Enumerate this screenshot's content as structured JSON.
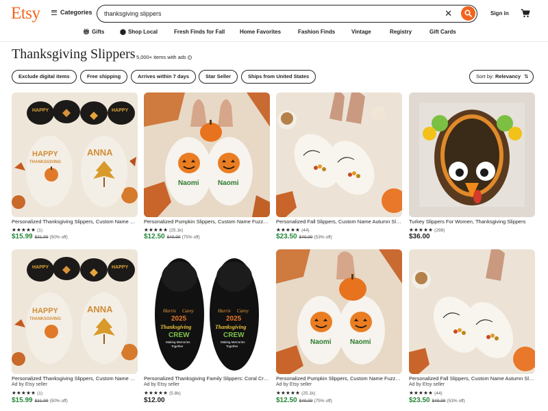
{
  "header": {
    "logo": "Etsy",
    "categories_label": "Categories",
    "search_value": "thanksgiving slippers",
    "signin_label": "Sign in"
  },
  "subnav": [
    {
      "label": "Gifts",
      "icon": "gift-icon"
    },
    {
      "label": "Shop Local",
      "icon": "location-pin-icon"
    },
    {
      "label": "Fresh Finds for Fall"
    },
    {
      "label": "Home Favorites"
    },
    {
      "label": "Fashion Finds"
    },
    {
      "label": "Vintage"
    },
    {
      "label": "Registry"
    },
    {
      "label": "Gift Cards"
    }
  ],
  "page": {
    "title": "Thanksgiving Slippers",
    "count": "5,000+ items with ads"
  },
  "filters": [
    "Exclude digital items",
    "Free shipping",
    "Arrives within 7 days",
    "Star Seller",
    "Ships from United States"
  ],
  "sort": {
    "prefix": "Sort by: ",
    "value": "Relevancy"
  },
  "listings": [
    {
      "title": "Personalized Thanksgiving Slippers, Custom Name Fall Slippers",
      "ad": "",
      "stars": "★★★★★",
      "reviews": "(1)",
      "price": "$15.99",
      "was": "$31.99",
      "off": "(50% off)",
      "sale": true
    },
    {
      "title": "Personalized Pumpkin Slippers, Custom Name Fuzzy Slippers",
      "ad": "",
      "stars": "★★★★★",
      "reviews": "(25.1k)",
      "price": "$12.50",
      "was": "$49.99",
      "off": "(75% off)",
      "sale": true
    },
    {
      "title": "Personalized Fall Slippers, Custom Name Autumn Slippers",
      "ad": "",
      "stars": "★★★★★",
      "reviews": "(44)",
      "price": "$23.50",
      "was": "$49.99",
      "off": "(53% off)",
      "sale": true
    },
    {
      "title": "Turkey Slippers For Women, Thanksgiving Slippers",
      "ad": "",
      "stars": "★★★★★",
      "reviews": "(298)",
      "price": "$36.00",
      "was": "",
      "off": "",
      "sale": false
    },
    {
      "title": "Personalized Thanksgiving Slippers, Custom Name Fall Slippers",
      "ad": "Ad by Etsy seller",
      "stars": "★★★★★",
      "reviews": "(1)",
      "price": "$15.99",
      "was": "$31.99",
      "off": "(50% off)",
      "sale": true
    },
    {
      "title": "Personalized Thanksgiving Family Slippers: Coral Crew Slippers",
      "ad": "Ad by Etsy seller",
      "stars": "★★★★★",
      "reviews": "(5.8k)",
      "price": "$12.00",
      "was": "",
      "off": "",
      "sale": false
    },
    {
      "title": "Personalized Pumpkin Slippers, Custom Name Fuzzy Slippers",
      "ad": "Ad by Etsy seller",
      "stars": "★★★★★",
      "reviews": "(25.1k)",
      "price": "$12.50",
      "was": "$49.99",
      "off": "(75% off)",
      "sale": true
    },
    {
      "title": "Personalized Fall Slippers, Custom Name Autumn Slippers",
      "ad": "Ad by Etsy seller",
      "stars": "★★★★★",
      "reviews": "(44)",
      "price": "$23.50",
      "was": "$49.99",
      "off": "(53% off)",
      "sale": true
    }
  ],
  "image_text": {
    "happy": "HAPPY",
    "thanksgiving": "THANKSGIVING",
    "anna": "ANNA",
    "naomi": "Naomi",
    "harris": "Harris",
    "carey": "Carey",
    "year": "2025",
    "crew_word": "Thanksgiving",
    "crew": "CREW",
    "memories": "Making Memories",
    "together": "Together"
  },
  "colors": {
    "brand": "#f1641e",
    "sale_price": "#238636"
  }
}
